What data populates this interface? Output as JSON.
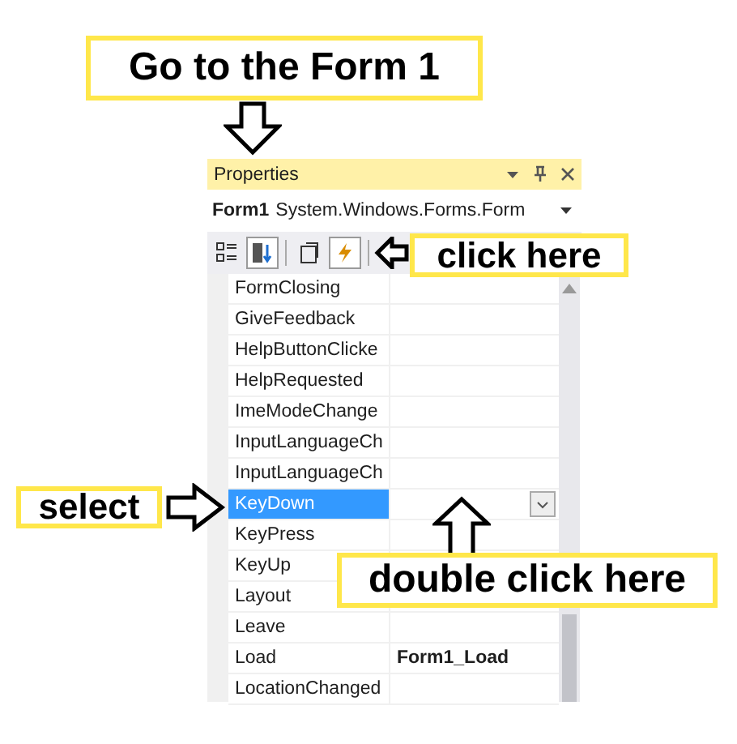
{
  "callouts": [
    {
      "text": "Go to the Form 1"
    },
    {
      "text": "click here"
    },
    {
      "text": "select"
    },
    {
      "text": "double click here"
    }
  ],
  "properties_panel": {
    "title": "Properties",
    "object_name": "Form1",
    "object_type": "System.Windows.Forms.Form",
    "toolbar": [
      {
        "kind": "categorized",
        "selected": false
      },
      {
        "kind": "alphabetical",
        "selected": true
      },
      {
        "kind": "property-pages",
        "selected": false
      },
      {
        "kind": "events",
        "selected": true
      }
    ],
    "rows": [
      {
        "name": "FormClosing",
        "value": "",
        "selected": false
      },
      {
        "name": "GiveFeedback",
        "selected": false
      },
      {
        "name": "HelpButtonClicke",
        "selected": false
      },
      {
        "name": "HelpRequested",
        "selected": false
      },
      {
        "name": "ImeModeChange",
        "selected": false
      },
      {
        "name": "InputLanguageCh",
        "selected": false
      },
      {
        "name": "InputLanguageCh",
        "selected": false
      },
      {
        "name": "KeyDown",
        "selected": true
      },
      {
        "name": "KeyPress",
        "selected": false
      },
      {
        "name": "KeyUp",
        "selected": false
      },
      {
        "name": "Layout",
        "selected": false
      },
      {
        "name": "Leave",
        "selected": false
      },
      {
        "name": "Load",
        "value": "Form1_Load",
        "selected": false
      },
      {
        "name": "LocationChanged",
        "selected": false
      }
    ]
  }
}
